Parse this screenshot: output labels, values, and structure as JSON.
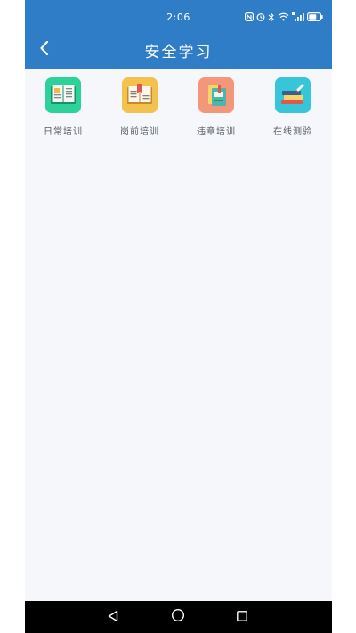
{
  "status_bar": {
    "time": "2:06",
    "icons": [
      "nfc-icon",
      "alarm-icon",
      "bluetooth-icon",
      "wifi-icon",
      "signal-4g-icon",
      "battery-icon"
    ]
  },
  "header": {
    "title": "安全学习",
    "back_icon": "chevron-left-icon",
    "background": "#2f7cc7"
  },
  "tiles": [
    {
      "label": "日常培训",
      "icon": "open-book-icon",
      "color": "#2dd29a"
    },
    {
      "label": "岗前培训",
      "icon": "bookmarked-book-icon",
      "color": "#f2c14e"
    },
    {
      "label": "违章培训",
      "icon": "notebook-stack-icon",
      "color": "#f3977a"
    },
    {
      "label": "在线测验",
      "icon": "book-pile-icon",
      "color": "#37c6d9"
    }
  ],
  "nav_bar": {
    "buttons": [
      "back-triangle-icon",
      "home-circle-icon",
      "recents-square-icon"
    ]
  }
}
